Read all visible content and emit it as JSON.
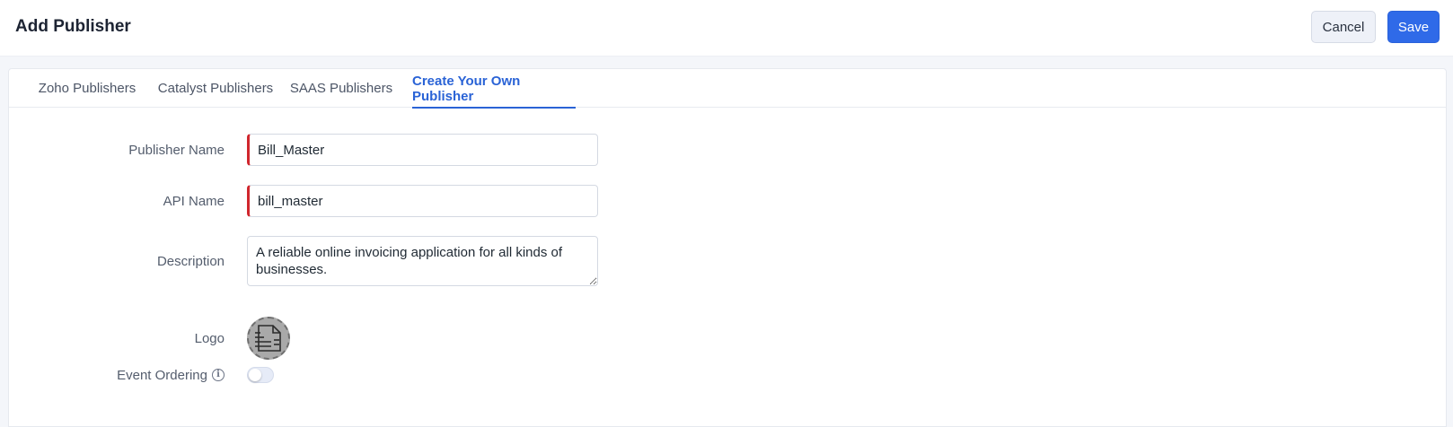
{
  "header": {
    "title": "Add Publisher",
    "cancel_label": "Cancel",
    "save_label": "Save"
  },
  "tabs": [
    {
      "label": "Zoho Publishers",
      "active": false
    },
    {
      "label": "Catalyst Publishers",
      "active": false
    },
    {
      "label": "SAAS Publishers",
      "active": false
    },
    {
      "label": "Create Your Own Publisher",
      "active": true
    }
  ],
  "form": {
    "publisher_name": {
      "label": "Publisher Name",
      "value": "Bill_Master",
      "required": true
    },
    "api_name": {
      "label": "API Name",
      "value": "bill_master",
      "required": true
    },
    "description": {
      "label": "Description",
      "value": "A reliable online invoicing application for all kinds of businesses."
    },
    "logo": {
      "label": "Logo",
      "icon": "document-icon"
    },
    "event_ordering": {
      "label": "Event Ordering",
      "enabled": false,
      "icon": "info-icon"
    }
  },
  "colors": {
    "accent": "#2f6ae8",
    "required_marker": "#d0262d",
    "active_tab": "#2a63d6"
  }
}
